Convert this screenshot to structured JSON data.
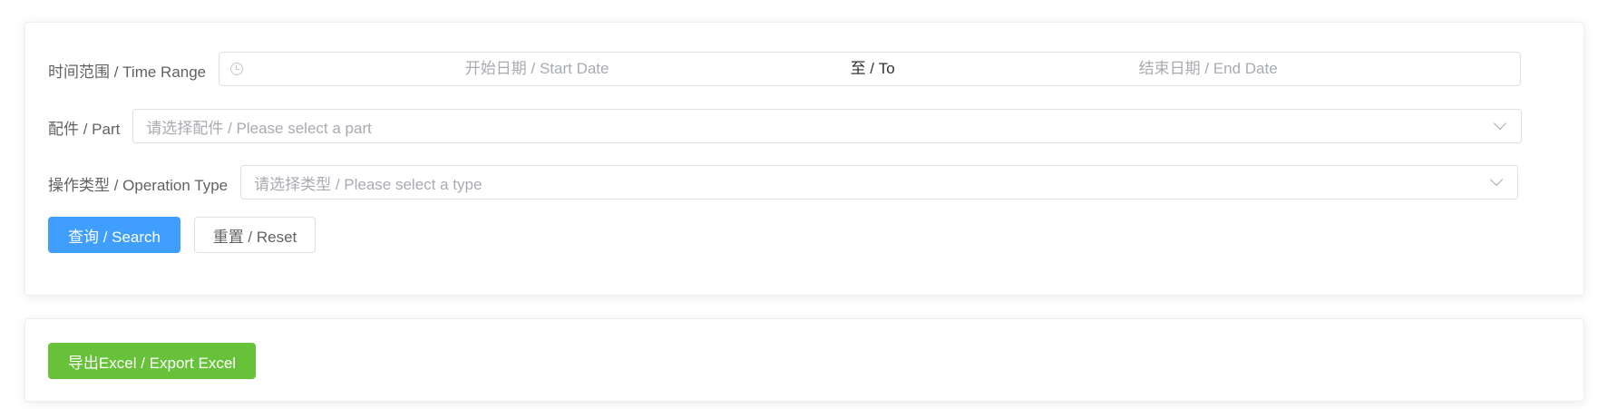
{
  "filters": {
    "time_range": {
      "label": "时间范围 / Time Range",
      "start_placeholder": "开始日期 / Start Date",
      "separator": "至 / To",
      "end_placeholder": "结束日期 / End Date",
      "icon": "clock-icon"
    },
    "part": {
      "label": "配件 / Part",
      "placeholder": "请选择配件 / Please select a part",
      "icon": "chevron-down-icon"
    },
    "operation_type": {
      "label": "操作类型 / Operation Type",
      "placeholder": "请选择类型 / Please select a type",
      "icon": "chevron-down-icon"
    },
    "buttons": {
      "search_label": "查询 / Search",
      "reset_label": "重置 / Reset"
    }
  },
  "export": {
    "button_label": "导出Excel / Export Excel"
  },
  "colors": {
    "primary": "#409eff",
    "success": "#67c23a",
    "border": "#dcdfe6",
    "placeholder": "#a8abb2",
    "label": "#606266"
  }
}
